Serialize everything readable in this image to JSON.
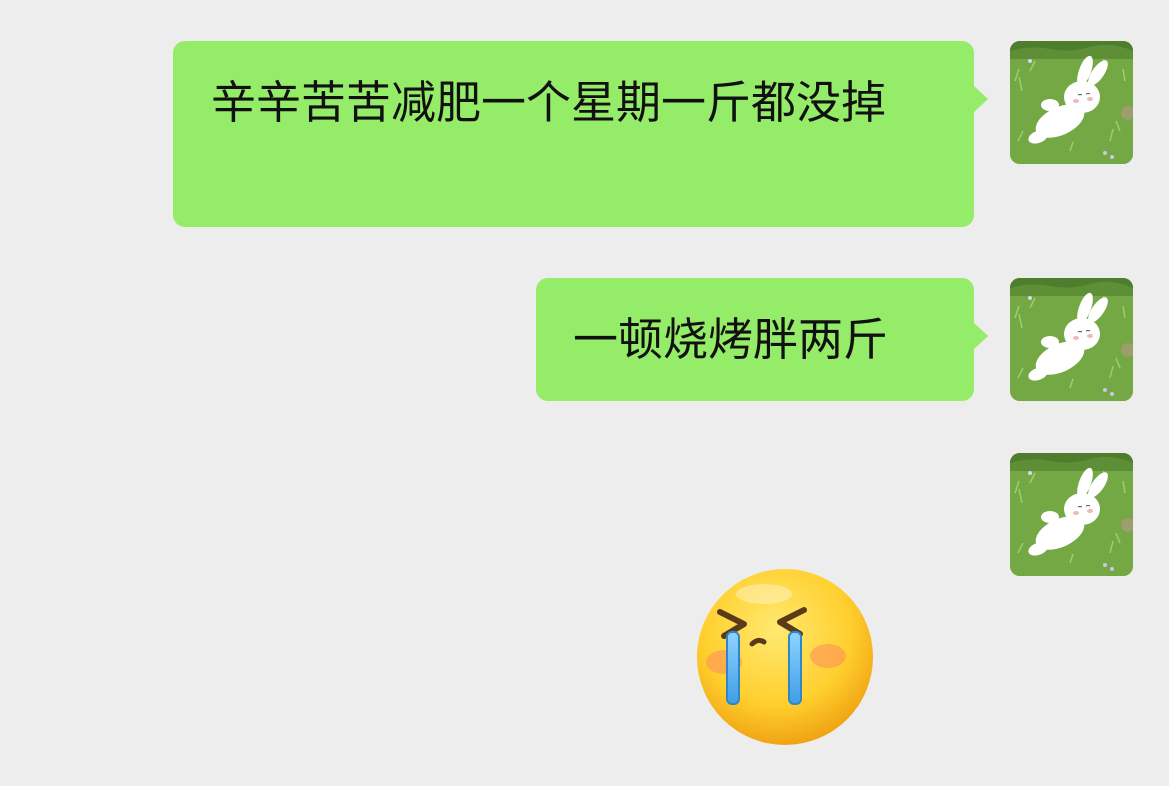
{
  "messages": [
    {
      "sender": "self",
      "type": "text",
      "text": "辛辛苦苦减肥一个星期一斤都没掉",
      "avatar_icon": "white-rabbit-on-grass-avatar"
    },
    {
      "sender": "self",
      "type": "text",
      "text": "一顿烧烤胖两斤",
      "avatar_icon": "white-rabbit-on-grass-avatar"
    },
    {
      "sender": "self",
      "type": "sticker",
      "sticker_icon": "crying-face-emoji",
      "avatar_icon": "white-rabbit-on-grass-avatar"
    }
  ],
  "colors": {
    "background": "#ededed",
    "self_bubble": "#95ec69",
    "text": "#111111"
  }
}
